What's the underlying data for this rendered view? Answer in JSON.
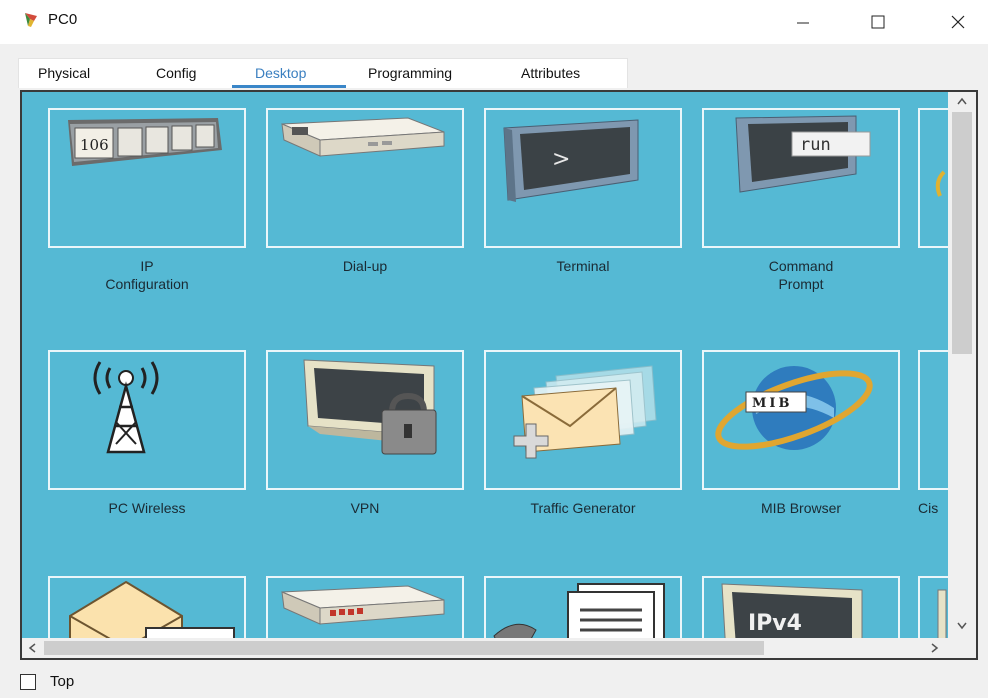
{
  "window": {
    "title": "PC0",
    "app_icon": "packet-tracer-pc-icon",
    "controls": {
      "minimize": "minimize-icon",
      "maximize": "maximize-icon",
      "close": "close-icon"
    }
  },
  "tabs": [
    {
      "label": "Physical",
      "active": false
    },
    {
      "label": "Config",
      "active": false
    },
    {
      "label": "Desktop",
      "active": true
    },
    {
      "label": "Programming",
      "active": false
    },
    {
      "label": "Attributes",
      "active": false
    }
  ],
  "desktop": {
    "rows": [
      [
        {
          "label_lines": [
            "IP",
            "Configuration"
          ],
          "icon": "ip-configuration-icon",
          "icon_text": "106"
        },
        {
          "label_lines": [
            "Dial-up"
          ],
          "icon": "dial-up-modem-icon"
        },
        {
          "label_lines": [
            "Terminal"
          ],
          "icon": "terminal-icon",
          "icon_text": ">"
        },
        {
          "label_lines": [
            "Command",
            "Prompt"
          ],
          "icon": "command-prompt-icon",
          "icon_text": "run"
        }
      ],
      [
        {
          "label_lines": [
            "PC Wireless"
          ],
          "icon": "wireless-antenna-icon"
        },
        {
          "label_lines": [
            "VPN"
          ],
          "icon": "vpn-lock-icon"
        },
        {
          "label_lines": [
            "Traffic Generator"
          ],
          "icon": "traffic-generator-icon"
        },
        {
          "label_lines": [
            "MIB Browser"
          ],
          "icon": "mib-browser-icon",
          "icon_text": "MIB"
        }
      ],
      [
        {
          "label_lines": [
            ""
          ],
          "icon": "email-icon"
        },
        {
          "label_lines": [
            ""
          ],
          "icon": "pppoe-dialer-icon"
        },
        {
          "label_lines": [
            ""
          ],
          "icon": "text-editor-icon"
        },
        {
          "label_lines": [
            ""
          ],
          "icon": "ipv6-icon",
          "icon_text": "IPv4"
        }
      ]
    ],
    "partial_column_label": "Cis"
  },
  "bottom": {
    "top_checkbox_label": "Top",
    "top_checked": false
  },
  "colors": {
    "desktop_bg": "#55b9d4",
    "tile_border": "#eaf6fa",
    "active_tab": "#3a7fc0"
  }
}
